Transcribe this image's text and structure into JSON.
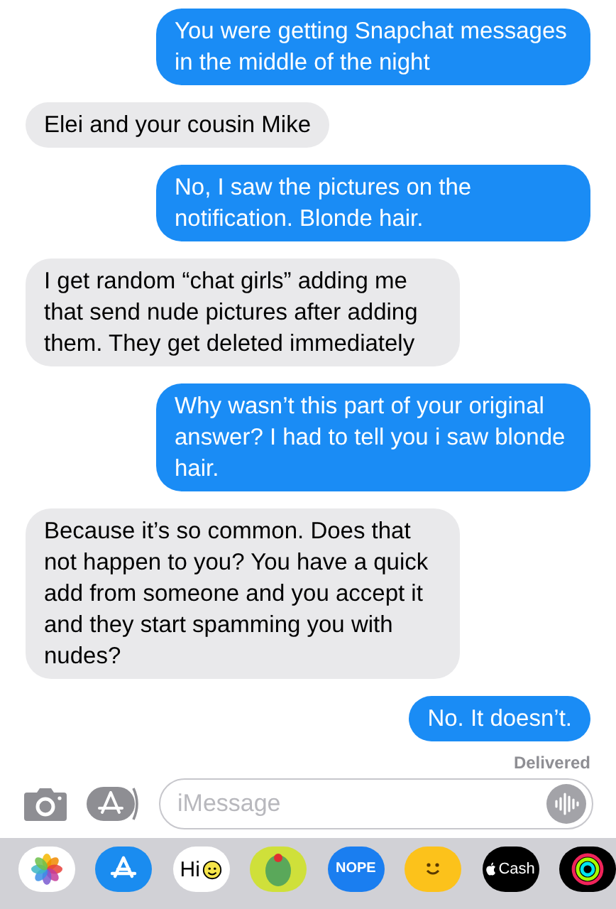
{
  "messages": [
    {
      "kind": "sent",
      "text": "You were getting Snapchat messages in the middle of the night"
    },
    {
      "kind": "received",
      "text": "Elei and your cousin Mike"
    },
    {
      "kind": "sent",
      "text": "No, I saw the pictures on the notification. Blonde hair."
    },
    {
      "kind": "received",
      "text": "I get random “chat girls” adding me that send nude pictures after adding them. They get deleted immediately"
    },
    {
      "kind": "sent",
      "text": "Why wasn’t this part of your original answer? I had to tell you i saw blonde hair."
    },
    {
      "kind": "received",
      "text": "Because it’s so common. Does that not happen to you? You have a quick add from someone and you accept it and they start spamming you with nudes?"
    },
    {
      "kind": "sent",
      "text": "No. It doesn’t."
    }
  ],
  "status": "Delivered",
  "composer": {
    "placeholder": "iMessage"
  },
  "apps": [
    {
      "kind": "photos"
    },
    {
      "kind": "appstore"
    },
    {
      "kind": "hi",
      "label": "Hi"
    },
    {
      "kind": "olive"
    },
    {
      "kind": "nope",
      "label": "NOPE"
    },
    {
      "kind": "memoji"
    },
    {
      "kind": "cash",
      "label": "Cash"
    },
    {
      "kind": "activity"
    }
  ]
}
